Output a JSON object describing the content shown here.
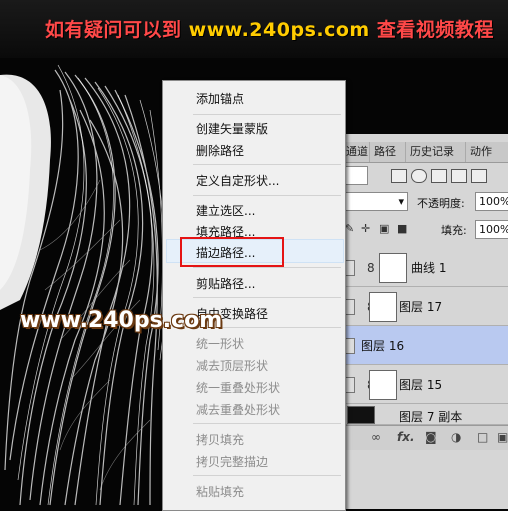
{
  "banner": {
    "prefix": "如有疑问可以到",
    "url": "www.240ps.com",
    "suffix": "查看视频教程"
  },
  "watermark": "www.240ps.com",
  "context_menu": {
    "items": [
      {
        "label": "添加锚点",
        "enabled": true
      },
      {
        "label": "创建矢量蒙版",
        "enabled": true
      },
      {
        "label": "删除路径",
        "enabled": true
      },
      {
        "label": "定义自定形状...",
        "enabled": true
      },
      {
        "label": "建立选区...",
        "enabled": true
      },
      {
        "label": "填充路径...",
        "enabled": true
      },
      {
        "label": "描边路径...",
        "enabled": true,
        "highlighted": true
      },
      {
        "label": "剪贴路径...",
        "enabled": true
      },
      {
        "label": "自由变换路径",
        "enabled": true
      },
      {
        "label": "统一形状",
        "enabled": false
      },
      {
        "label": "减去顶层形状",
        "enabled": false
      },
      {
        "label": "统一重叠处形状",
        "enabled": false
      },
      {
        "label": "减去重叠处形状",
        "enabled": false
      },
      {
        "label": "拷贝填充",
        "enabled": false
      },
      {
        "label": "拷贝完整描边",
        "enabled": false
      },
      {
        "label": "粘贴填充",
        "enabled": false
      }
    ]
  },
  "layers_panel": {
    "tabs": [
      "通道",
      "路径",
      "历史记录",
      "动作"
    ],
    "opacity_label": "不透明度:",
    "opacity_value": "100%",
    "fill_label": "填充:",
    "fill_value": "100%",
    "layers": [
      {
        "name": "曲线 1",
        "link": "8",
        "selected": false
      },
      {
        "name": "图层 17",
        "link": "8",
        "selected": false
      },
      {
        "name": "图层 16",
        "link": "",
        "selected": true
      },
      {
        "name": "图层 15",
        "link": "8",
        "selected": false
      },
      {
        "name": "图层 7 副本",
        "link": "",
        "selected": false
      }
    ],
    "footer_fx": "fx."
  },
  "colors": {
    "highlight_box": "#e51414",
    "selected_layer": "#b9c9f0",
    "banner_text": "#ff4848",
    "banner_url": "#ffcc00"
  }
}
